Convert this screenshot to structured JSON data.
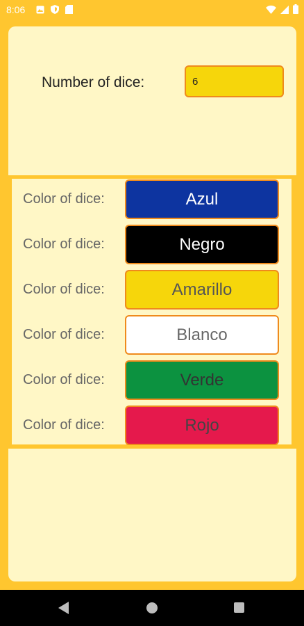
{
  "status_bar": {
    "time": "8:06",
    "left_icons": [
      "image-icon",
      "shield-icon",
      "sd-card-icon"
    ],
    "right_icons": [
      "wifi-icon",
      "signal-icon",
      "battery-icon"
    ]
  },
  "form": {
    "number_label": "Number of dice:",
    "number_value": "6"
  },
  "dice_rows": [
    {
      "label": "Color of dice:",
      "color_name": "Azul",
      "bg": "#0D34A0",
      "fg": "#FFFFFF"
    },
    {
      "label": "Color of dice:",
      "color_name": "Negro",
      "bg": "#000000",
      "fg": "#FFFFFF"
    },
    {
      "label": "Color of dice:",
      "color_name": "Amarillo",
      "bg": "#F6D60B",
      "fg": "#555555"
    },
    {
      "label": "Color of dice:",
      "color_name": "Blanco",
      "bg": "#FFFFFF",
      "fg": "#666666"
    },
    {
      "label": "Color of dice:",
      "color_name": "Verde",
      "bg": "#0C9240",
      "fg": "#333333"
    },
    {
      "label": "Color of dice:",
      "color_name": "Rojo",
      "bg": "#E5194C",
      "fg": "#444444"
    }
  ],
  "colors": {
    "app_background": "#FFC62F",
    "panel_background": "#FFF7C6",
    "button_border": "#EF8A1C"
  },
  "nav_bar": {
    "icons": [
      "back-icon",
      "home-icon",
      "recent-apps-icon"
    ]
  }
}
